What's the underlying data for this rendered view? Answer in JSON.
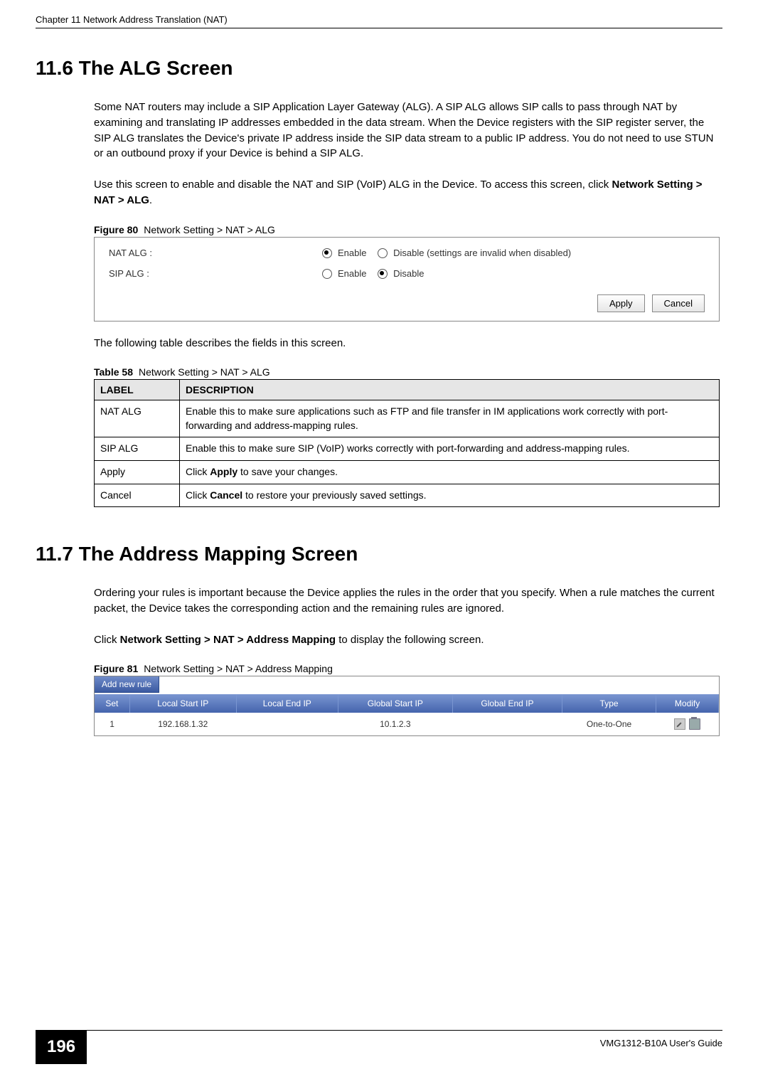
{
  "running_head": "Chapter 11 Network Address Translation (NAT)",
  "section_11_6": {
    "title": "11.6  The ALG Screen",
    "para1": "Some NAT routers may include a SIP Application Layer Gateway (ALG). A SIP ALG allows SIP calls to pass through NAT by examining and translating IP addresses embedded in the data stream. When the Device registers with the SIP register server, the SIP ALG translates the Device's private IP address inside the SIP data stream to a public IP address. You do not need to use STUN or an outbound proxy if your Device is behind a SIP ALG.",
    "para2_pre": "Use this screen to enable and disable the NAT and SIP (VoIP) ALG in the Device. To access this screen, click ",
    "para2_bold": "Network Setting > NAT > ALG",
    "para2_post": "."
  },
  "figure80": {
    "label": "Figure 80",
    "caption": "Network Setting > NAT > ALG",
    "rows": {
      "nat": {
        "label": "NAT ALG :",
        "enable": "Enable",
        "disable_text": "Disable (settings are invalid when disabled)"
      },
      "sip": {
        "label": "SIP ALG :",
        "enable": "Enable",
        "disable": "Disable"
      }
    },
    "buttons": {
      "apply": "Apply",
      "cancel": "Cancel"
    }
  },
  "table58_intro": "The following table describes the fields in this screen.",
  "table58": {
    "label": "Table 58",
    "caption": "Network Setting > NAT > ALG",
    "headers": {
      "label": "LABEL",
      "desc": "DESCRIPTION"
    },
    "rows": [
      {
        "label": "NAT ALG",
        "desc": "Enable this to make sure applications such as FTP and file transfer in IM applications work correctly with port-forwarding and address-mapping rules."
      },
      {
        "label": "SIP ALG",
        "desc": "Enable this to make sure SIP (VoIP) works correctly with port-forwarding and address-mapping rules."
      },
      {
        "label": "Apply",
        "desc_pre": "Click ",
        "desc_bold": "Apply",
        "desc_post": " to save your changes."
      },
      {
        "label": "Cancel",
        "desc_pre": "Click ",
        "desc_bold": "Cancel",
        "desc_post": " to restore your previously saved settings."
      }
    ]
  },
  "section_11_7": {
    "title": "11.7  The Address Mapping Screen",
    "para1": "Ordering your rules is important because the Device applies the rules in the order that you specify. When a rule matches the current packet, the Device takes the corresponding action and the remaining rules are ignored.",
    "para2_pre": "Click ",
    "para2_bold": "Network Setting > NAT > Address Mapping",
    "para2_post": " to display the following screen."
  },
  "figure81": {
    "label": "Figure 81",
    "caption": "Network Setting > NAT > Address Mapping",
    "add_rule": "Add new rule",
    "headers": [
      "Set",
      "Local Start IP",
      "Local End IP",
      "Global Start IP",
      "Global End IP",
      "Type",
      "Modify"
    ],
    "row": {
      "set": "1",
      "local_start": "192.168.1.32",
      "local_end": "",
      "global_start": "10.1.2.3",
      "global_end": "",
      "type": "One-to-One"
    }
  },
  "footer": {
    "page": "196",
    "guide": "VMG1312-B10A User's Guide"
  }
}
